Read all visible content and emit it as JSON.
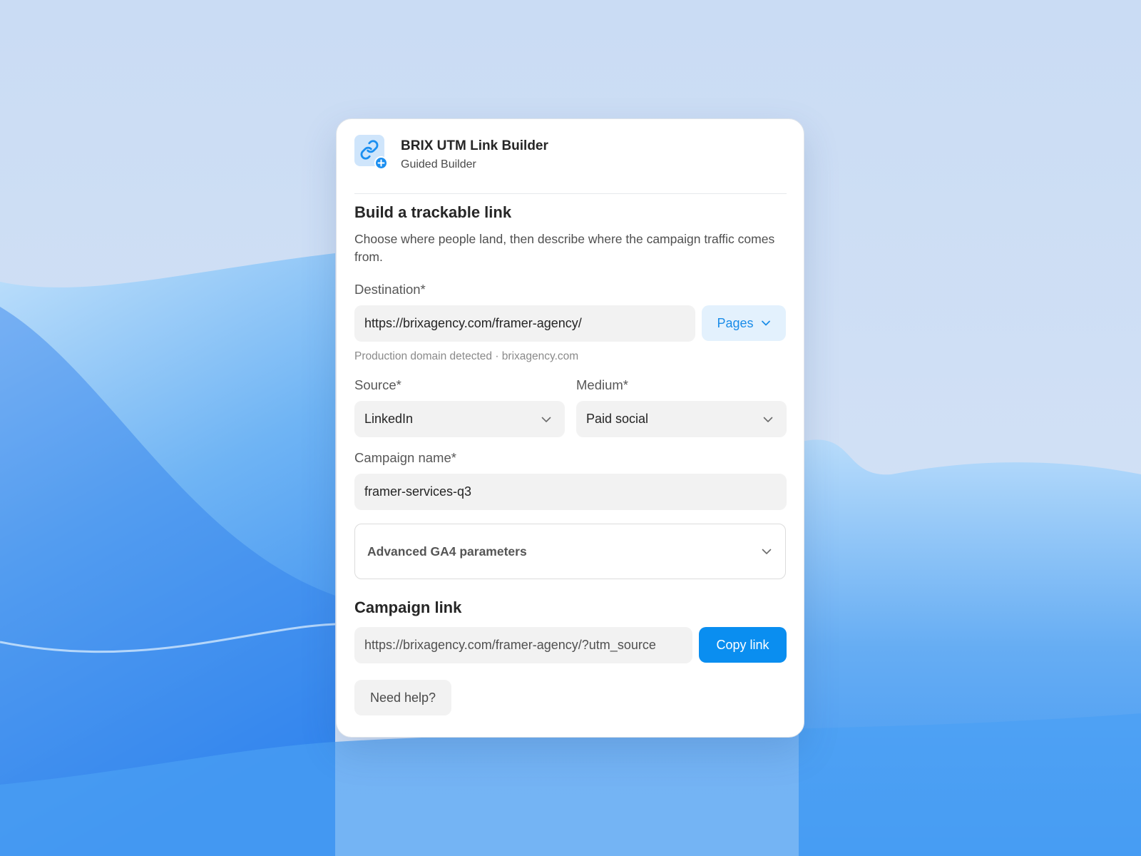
{
  "header": {
    "app_icon": "link-add-icon",
    "title": "BRIX UTM Link Builder",
    "subtitle": "Guided Builder"
  },
  "intro": {
    "heading": "Build a trackable link",
    "description": "Choose where people land, then describe where the campaign traffic comes from."
  },
  "destination": {
    "label": "Destination*",
    "value": "https://brixagency.com/framer-agency/",
    "pages_button": "Pages",
    "hint": "Production domain detected · brixagency.com"
  },
  "source": {
    "label": "Source*",
    "value": "LinkedIn"
  },
  "medium": {
    "label": "Medium*",
    "value": "Paid social"
  },
  "campaign": {
    "label": "Campaign name*",
    "value": "framer-services-q3"
  },
  "advanced": {
    "label": "Advanced GA4 parameters"
  },
  "output": {
    "heading": "Campaign link",
    "value": "https://brixagency.com/framer-agency/?utm_source",
    "copy_button": "Copy link"
  },
  "help_button": "Need help?",
  "colors": {
    "accent": "#0a8ef0",
    "accent_light": "#e3f1fd",
    "field_bg": "#f2f2f2",
    "card_bg": "#ffffff"
  }
}
